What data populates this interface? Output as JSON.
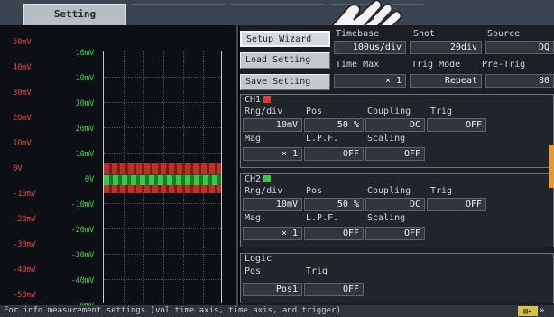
{
  "tabs": [
    {
      "label": "Setting",
      "active": true
    },
    {
      "label": "",
      "active": false
    },
    {
      "label": "",
      "active": false
    },
    {
      "label": "",
      "active": false
    }
  ],
  "scope": {
    "ch1_labels": [
      "50mV",
      "40mV",
      "30mV",
      "20mV",
      "10mV",
      "0V",
      "-10mV",
      "-20mV",
      "-30mV",
      "-40mV",
      "-50mV"
    ],
    "ch2_labels": [
      "10mV",
      "10mV",
      "30mV",
      "20mV",
      "10mV",
      "0V",
      "-10mV",
      "-20mV",
      "-30mV",
      "-40mV",
      "-10mV"
    ]
  },
  "buttons": {
    "setup_wizard": "Setup Wizard",
    "load_setting": "Load Setting",
    "save_setting": "Save Setting"
  },
  "timebase": {
    "header_timebase": "Timebase",
    "header_shot": "Shot",
    "header_source": "Source",
    "time_div": "100us/div",
    "shot": "20div",
    "source": "DQ",
    "header_timemax": "Time Max",
    "header_trigmode": "Trig Mode",
    "header_pretrig": "Pre-Trig",
    "timemax": "× 1",
    "trigmode": "Repeat",
    "pretrig": "80"
  },
  "ch1": {
    "title": "CH1",
    "hdr_range": "Rng/div",
    "hdr_pos": "Pos",
    "hdr_coupling": "Coupling",
    "hdr_trig": "Trig",
    "range": "10mV",
    "pos": "50 %",
    "coupling": "DC",
    "trig": "OFF",
    "hdr_mag": "Mag",
    "hdr_lpf": "L.P.F.",
    "hdr_scaling": "Scaling",
    "mag": "× 1",
    "lpf": "OFF",
    "scaling": "OFF",
    "color": "#d83a34"
  },
  "ch2": {
    "title": "CH2",
    "hdr_range": "Rng/div",
    "hdr_pos": "Pos",
    "hdr_coupling": "Coupling",
    "hdr_trig": "Trig",
    "range": "10mV",
    "pos": "50 %",
    "coupling": "DC",
    "trig": "OFF",
    "hdr_mag": "Mag",
    "hdr_lpf": "L.P.F.",
    "hdr_scaling": "Scaling",
    "mag": "× 1",
    "lpf": "OFF",
    "scaling": "OFF",
    "color": "#3ec84a"
  },
  "logic": {
    "title": "Logic",
    "hdr_pos": "Pos",
    "hdr_trig": "Trig",
    "pos": "Pos1",
    "trig": "OFF"
  },
  "status": {
    "text": "For info measurement settings (vol time axis, time axis, and trigger)",
    "icon": "page-icon"
  }
}
